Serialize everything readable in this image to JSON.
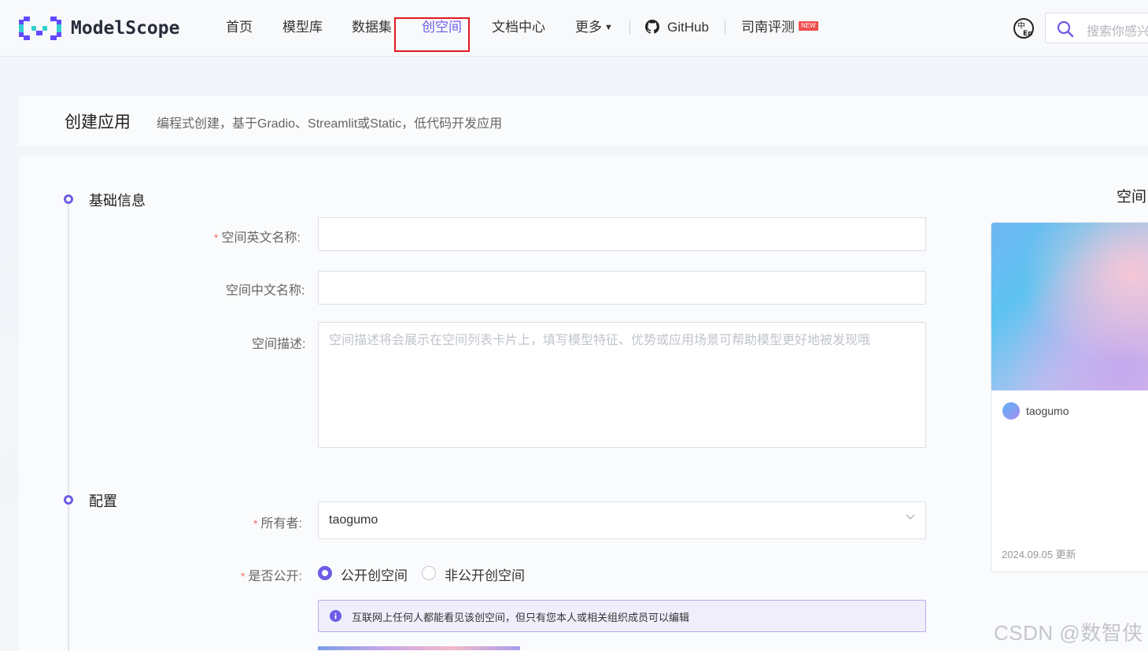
{
  "nav": {
    "logo_text": "ModelScope",
    "items": [
      {
        "label": "首页"
      },
      {
        "label": "模型库"
      },
      {
        "label": "数据集"
      },
      {
        "label": "创空间"
      },
      {
        "label": "文档中心"
      },
      {
        "label": "更多"
      },
      {
        "label": "GitHub"
      },
      {
        "label": "司南评测"
      }
    ],
    "new_badge": "NEW",
    "search_placeholder": "搜索你感兴趣"
  },
  "header": {
    "title": "创建应用",
    "subtitle": "编程式创建，基于Gradio、Streamlit或Static，低代码开发应用"
  },
  "form": {
    "basic_section": "基础信息",
    "en_name_label": "空间英文名称",
    "cn_name_label": "空间中文名称",
    "desc_label": "空间描述",
    "desc_placeholder": "空间描述将会展示在空间列表卡片上，填写模型特征、优势或应用场景可帮助模型更好地被发现哦",
    "config_section": "配置",
    "owner_label": "所有者",
    "owner_value": "taogumo",
    "public_label": "是否公开",
    "public_option": "公开创空间",
    "private_option": "非公开创空间",
    "info_text": "互联网上任何人都能看见该创空间，但只有您本人或相关组织成员可以编辑",
    "required_mark": "*",
    "colon": ":"
  },
  "preview": {
    "title": "空间",
    "owner": "taogumo",
    "updated": "2024.09.05 更新"
  },
  "watermark": "CSDN @数智侠",
  "colors": {
    "accent": "#6c5ce7",
    "highlight": "#e0191d"
  }
}
